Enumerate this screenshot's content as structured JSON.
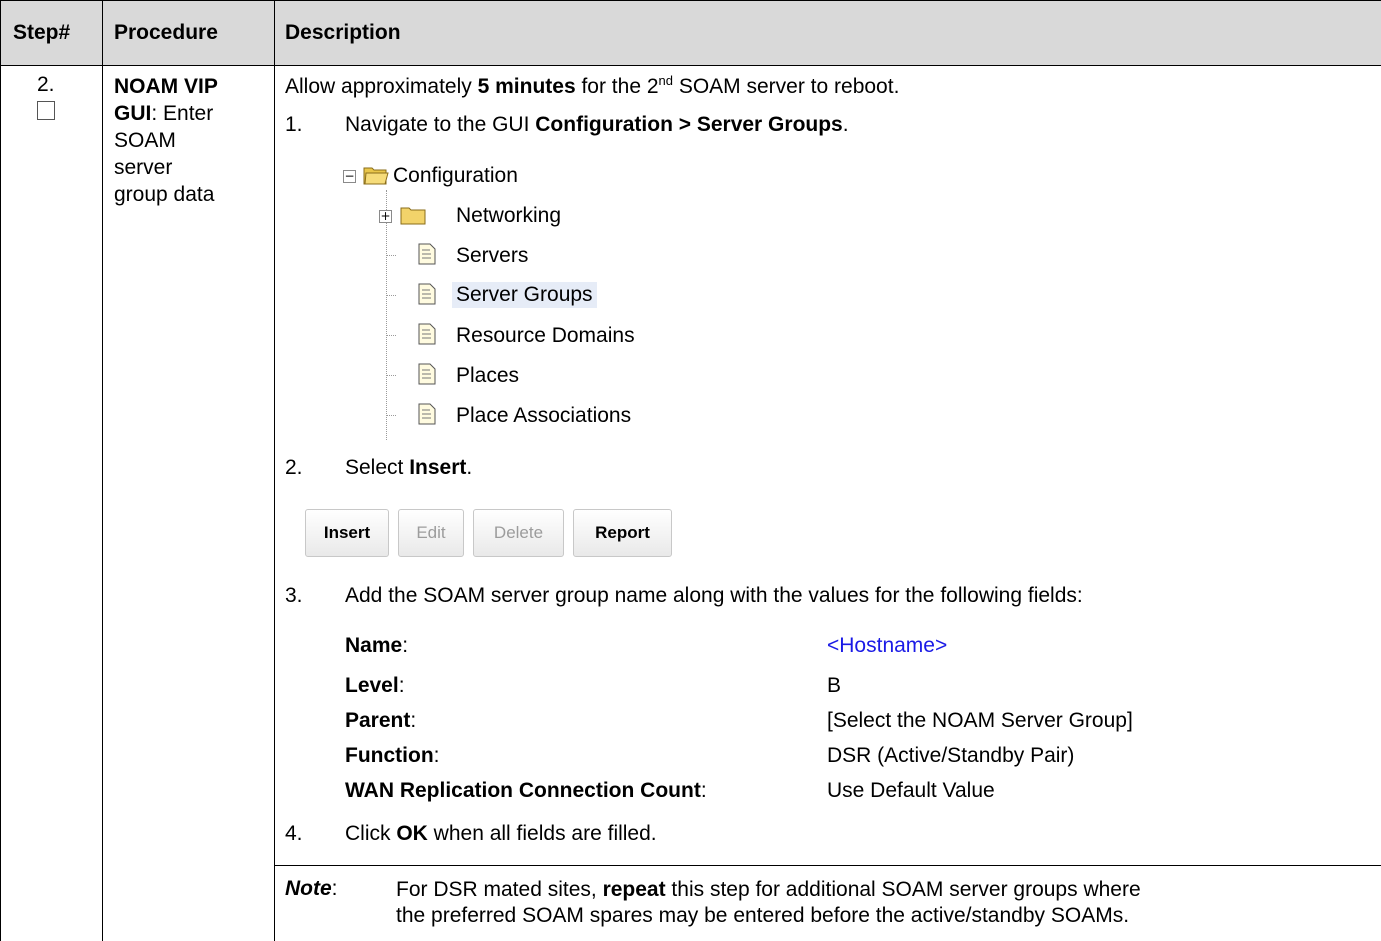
{
  "table": {
    "headers": {
      "step": "Step#",
      "procedure": "Procedure",
      "description": "Description"
    },
    "row": {
      "step_number": "2.",
      "procedure": {
        "part1": "NOAM VIP",
        "part2": "GUI",
        "part3": ": Enter",
        "line3": "SOAM",
        "line4": "server",
        "line5": "group data"
      },
      "intro": {
        "pre": "Allow approximately ",
        "bold": "5 minutes",
        "mid": " for the 2",
        "sup": "nd",
        "post": " SOAM server to reboot."
      },
      "step1": {
        "num": "1.",
        "pre": "Navigate to the GUI ",
        "bold": "Configuration > Server Groups",
        "post": "."
      },
      "tree": {
        "root": "Configuration",
        "items": [
          "Networking",
          "Servers",
          "Server Groups",
          "Resource Domains",
          "Places",
          "Place Associations"
        ]
      },
      "step2": {
        "num": "2.",
        "pre": "Select ",
        "bold": "Insert",
        "post": "."
      },
      "buttons": {
        "insert": "Insert",
        "edit": "Edit",
        "delete": "Delete",
        "report": "Report"
      },
      "step3": {
        "num": "3.",
        "text": "Add the SOAM server group name along with the values for the following fields:"
      },
      "fields": [
        {
          "label": "Name",
          "value": "<Hostname>"
        },
        {
          "label": "Level",
          "value": "B"
        },
        {
          "label": "Parent",
          "value": "[Select the NOAM Server Group]"
        },
        {
          "label": "Function",
          "value": "DSR (Active/Standby Pair)"
        },
        {
          "label": "WAN Replication Connection Count",
          "value": "Use Default Value"
        }
      ],
      "step4": {
        "num": "4.",
        "pre": "Click ",
        "bold": "OK",
        "post": " when all fields are filled."
      },
      "note": {
        "label": "Note",
        "colon": ":",
        "line1_pre": "For DSR mated sites, ",
        "line1_bold": "repeat",
        "line1_post": " this step for additional SOAM server groups where",
        "line2": "the preferred SOAM spares may be entered before the active/standby SOAMs."
      }
    }
  },
  "colors": {
    "header_bg": "#d9d9d9",
    "link": "#1a1ae6"
  }
}
